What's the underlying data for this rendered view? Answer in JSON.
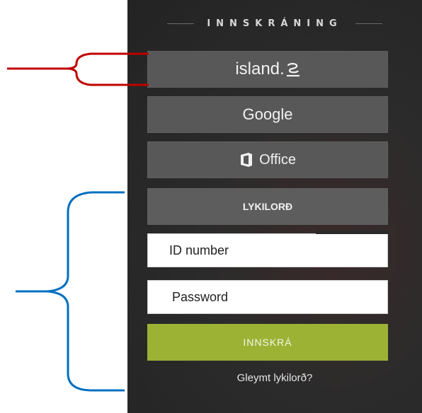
{
  "panel": {
    "title": "INNSKRÁNING"
  },
  "providers": {
    "island_label": "island.",
    "island_mark": "is",
    "google_label": "Google",
    "office_label": "Office",
    "password_tab_label": "LYKILORÐ"
  },
  "form": {
    "id_field_text": "ID number",
    "password_field_text": "Password",
    "login_label": "INNSKRÁ",
    "forgot_label": "Gleymt lykilorð?"
  },
  "colors": {
    "panel_bg": "#2b2b2b",
    "provider_btn": "#585858",
    "login_btn": "#9bb235",
    "annotation_red": "#c00000",
    "annotation_blue": "#0070c0"
  },
  "icons": {
    "office": "office-icon",
    "island_mark": "island-is-mark-icon"
  }
}
